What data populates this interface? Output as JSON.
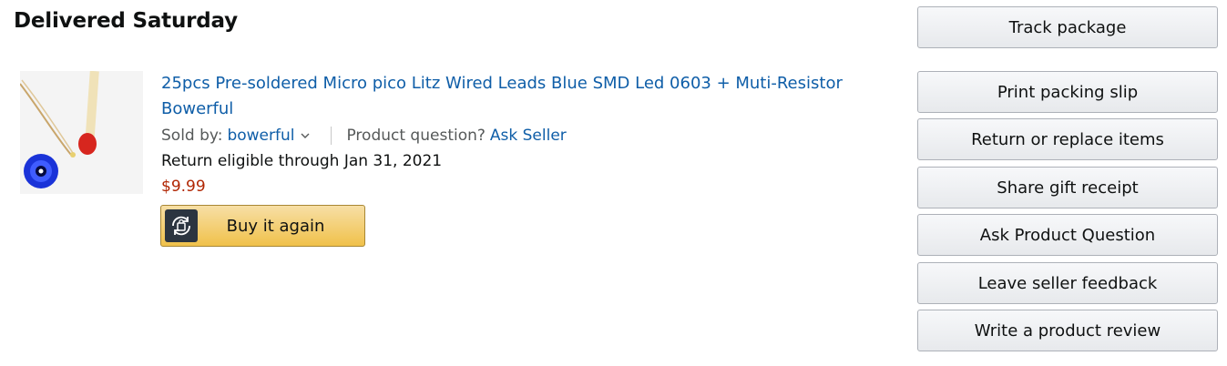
{
  "shipment": {
    "status": "Delivered Saturday"
  },
  "product": {
    "title": "25pcs Pre-soldered Micro pico Litz Wired Leads Blue SMD Led 0603 + Muti-Resistor Bowerful",
    "sold_by_label": "Sold by:",
    "seller": "bowerful",
    "question_label": "Product question?",
    "ask_seller": "Ask Seller",
    "return_eligibility": "Return eligible through Jan 31, 2021",
    "price": "$9.99",
    "image_icon": "product-photo"
  },
  "buy_again": {
    "label": "Buy it again",
    "icon": "buy-again-icon"
  },
  "actions": [
    {
      "label": "Track package"
    },
    {
      "label": "Print packing slip"
    },
    {
      "label": "Return or replace items"
    },
    {
      "label": "Share gift receipt"
    },
    {
      "label": "Ask Product Question"
    },
    {
      "label": "Leave seller feedback"
    },
    {
      "label": "Write a product review"
    }
  ],
  "colors": {
    "link": "#0f5ea8",
    "price": "#b12704",
    "buy_button": "#f0c14b",
    "secondary_button": "#e7e9ec"
  }
}
